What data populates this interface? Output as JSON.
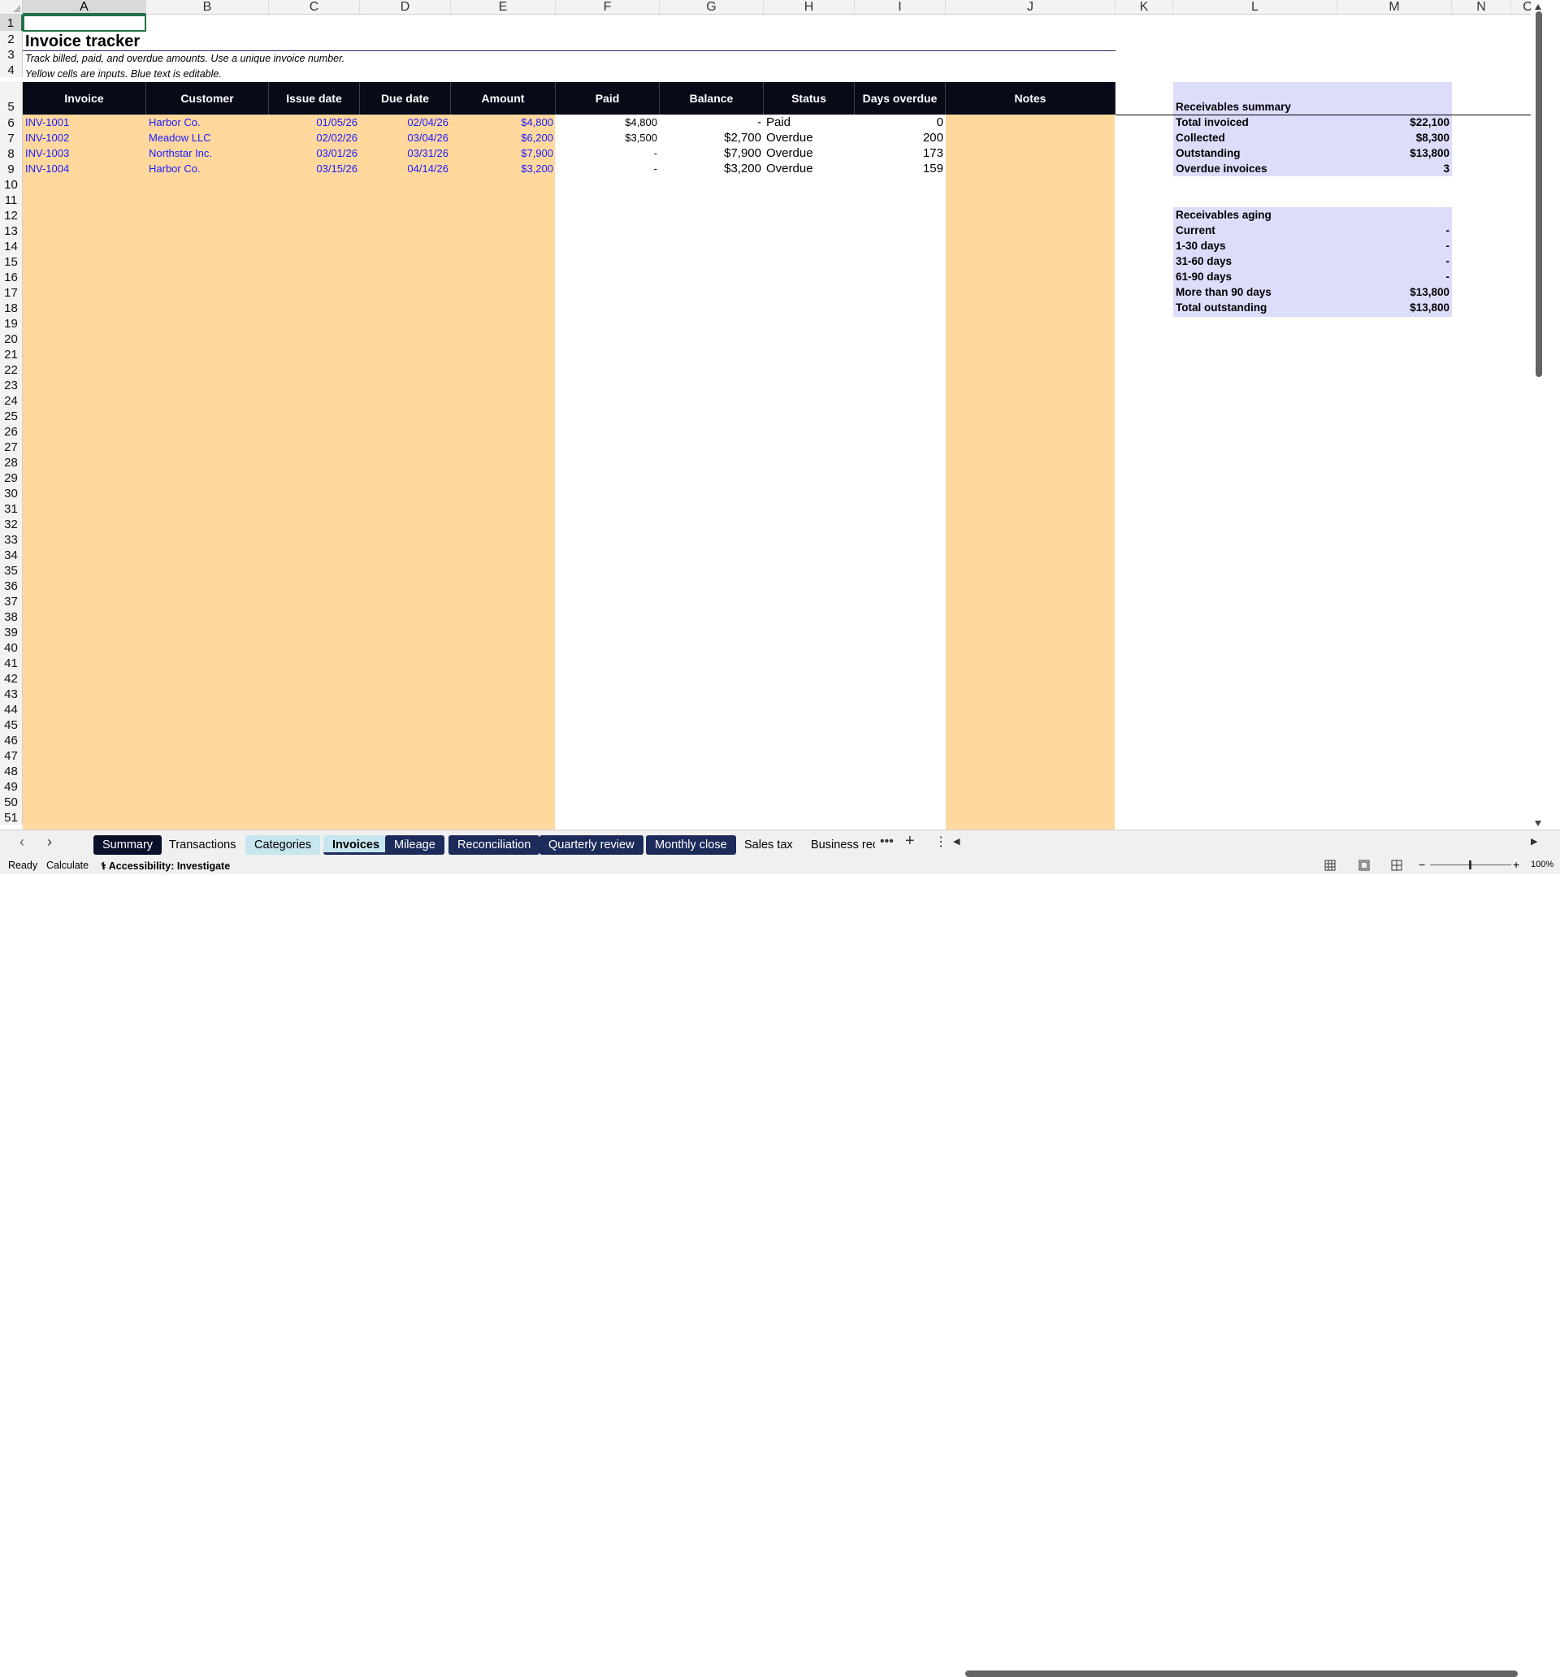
{
  "columns": [
    {
      "letter": "A"
    },
    {
      "letter": "B"
    },
    {
      "letter": "C"
    },
    {
      "letter": "D"
    },
    {
      "letter": "E"
    },
    {
      "letter": "F"
    },
    {
      "letter": "G"
    },
    {
      "letter": "H"
    },
    {
      "letter": "I"
    },
    {
      "letter": "J"
    },
    {
      "letter": "K"
    },
    {
      "letter": "L"
    },
    {
      "letter": "M"
    },
    {
      "letter": "N"
    },
    {
      "letter": "O"
    }
  ],
  "sheet": {
    "title": "Invoice tracker",
    "note1": "Track billed, paid, and overdue amounts. Use a unique invoice number.",
    "note2": "Yellow cells are inputs. Blue text is editable.",
    "headers": [
      "Invoice",
      "Customer",
      "Issue date",
      "Due date",
      "Amount",
      "Paid",
      "Balance",
      "Status",
      "Days overdue",
      "Notes"
    ],
    "rows": [
      {
        "invoice": "INV-1001",
        "customer": "Harbor Co.",
        "issue": "01/05/26",
        "due": "02/04/26",
        "amount": "$4,800",
        "paid": "$4,800",
        "balance": "-",
        "status": "Paid",
        "days": "0"
      },
      {
        "invoice": "INV-1002",
        "customer": "Meadow LLC",
        "issue": "02/02/26",
        "due": "03/04/26",
        "amount": "$6,200",
        "paid": "$3,500",
        "balance": "$2,700",
        "status": "Overdue",
        "days": "200"
      },
      {
        "invoice": "INV-1003",
        "customer": "Northstar Inc.",
        "issue": "03/01/26",
        "due": "03/31/26",
        "amount": "$7,900",
        "paid": "-",
        "balance": "$7,900",
        "status": "Overdue",
        "days": "173"
      },
      {
        "invoice": "INV-1004",
        "customer": "Harbor Co.",
        "issue": "03/15/26",
        "due": "04/14/26",
        "amount": "$3,200",
        "paid": "-",
        "balance": "$3,200",
        "status": "Overdue",
        "days": "159"
      }
    ]
  },
  "summary": {
    "title": "Receivables summary",
    "items": [
      {
        "label": "Total invoiced",
        "value": "$22,100"
      },
      {
        "label": "Collected",
        "value": "$8,300"
      },
      {
        "label": "Outstanding",
        "value": "$13,800"
      },
      {
        "label": "Overdue invoices",
        "value": "3"
      }
    ]
  },
  "aging": {
    "title": "Receivables aging",
    "items": [
      {
        "label": "Current",
        "value": "-"
      },
      {
        "label": "1-30 days",
        "value": "-"
      },
      {
        "label": "31-60 days",
        "value": "-"
      },
      {
        "label": "61-90 days",
        "value": "-"
      },
      {
        "label": "More than 90 days",
        "value": "$13,800"
      },
      {
        "label": "Total outstanding",
        "value": "$13,800"
      }
    ]
  },
  "tabs": [
    {
      "label": "Summary",
      "style": "dark"
    },
    {
      "label": "Transactions",
      "style": "plain"
    },
    {
      "label": "Categories",
      "style": "light"
    },
    {
      "label": "Invoices",
      "style": "active"
    },
    {
      "label": "Mileage",
      "style": "navy"
    },
    {
      "label": "Reconciliation",
      "style": "navy"
    },
    {
      "label": "Quarterly review",
      "style": "navy"
    },
    {
      "label": "Monthly close",
      "style": "navy"
    },
    {
      "label": "Sales tax",
      "style": "plain"
    },
    {
      "label": "Business rec",
      "style": "plain"
    }
  ],
  "status": {
    "ready": "Ready",
    "calculate": "Calculate",
    "accessibility": "Accessibility: Investigate",
    "zoom": "100%"
  },
  "colors": {
    "input_fill": "#ffd89e",
    "header_fill": "#070b17",
    "summary_fill": "#dcdcfb",
    "input_text": "#1a1aff"
  }
}
